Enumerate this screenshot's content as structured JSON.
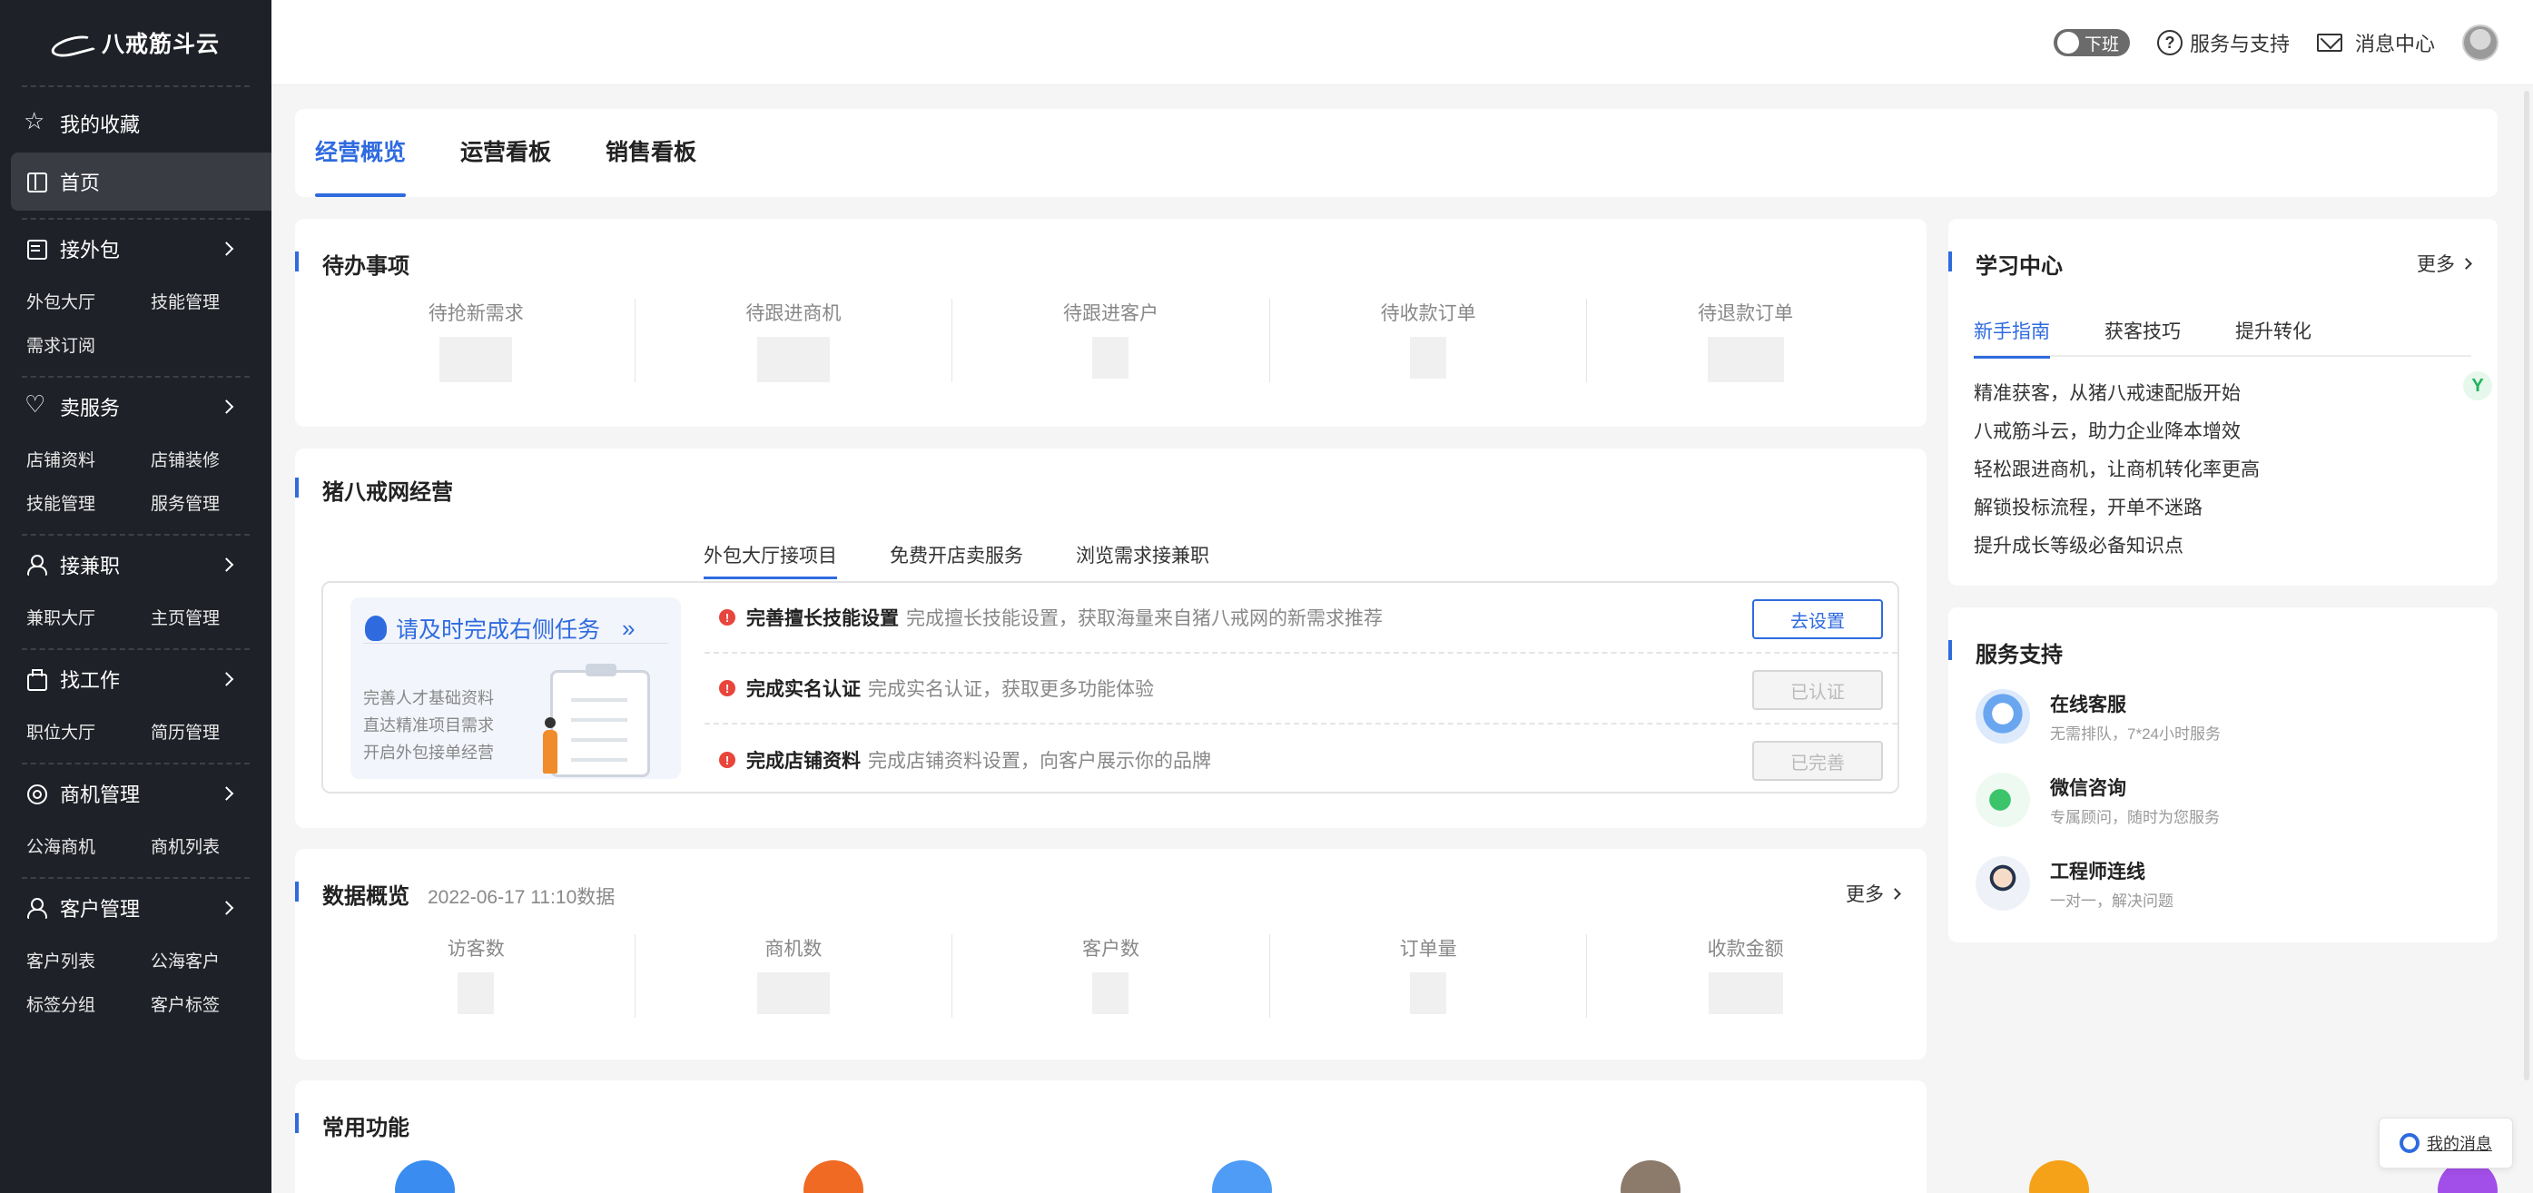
{
  "brand": {
    "name": "八戒筋斗云"
  },
  "sidebar": {
    "favorites": "我的收藏",
    "home": "首页",
    "groups": [
      {
        "label": "接外包",
        "subs": [
          "外包大厅",
          "技能管理",
          "需求订阅"
        ]
      },
      {
        "label": "卖服务",
        "subs": [
          "店铺资料",
          "店铺装修",
          "技能管理",
          "服务管理"
        ]
      },
      {
        "label": "接兼职",
        "subs": [
          "兼职大厅",
          "主页管理"
        ]
      },
      {
        "label": "找工作",
        "subs": [
          "职位大厅",
          "简历管理"
        ]
      },
      {
        "label": "商机管理",
        "subs": [
          "公海商机",
          "商机列表"
        ]
      },
      {
        "label": "客户管理",
        "subs": [
          "客户列表",
          "公海客户",
          "标签分组",
          "客户标签"
        ]
      }
    ]
  },
  "topbar": {
    "toggle_label": "下班",
    "support": "服务与支持",
    "messages": "消息中心"
  },
  "main_tabs": [
    "经营概览",
    "运营看板",
    "销售看板"
  ],
  "todo": {
    "title": "待办事项",
    "stats": [
      "待抢新需求",
      "待跟进商机",
      "待跟进客户",
      "待收款订单",
      "待退款订单"
    ]
  },
  "biz": {
    "title": "猪八戒网经营",
    "tabs": [
      "外包大厅接项目",
      "免费开店卖服务",
      "浏览需求接兼职"
    ],
    "promo_title": "请及时完成右侧任务",
    "promo_lines": [
      "完善人才基础资料",
      "直达精准项目需求",
      "开启外包接单经营"
    ],
    "tasks": [
      {
        "name": "完善擅长技能设置",
        "desc": "完成擅长技能设置，获取海量来自猪八戒网的新需求推荐",
        "button": "去设置",
        "state": "primary"
      },
      {
        "name": "完成实名认证",
        "desc": "完成实名认证，获取更多功能体验",
        "button": "已认证",
        "state": "disabled"
      },
      {
        "name": "完成店铺资料",
        "desc": "完成店铺资料设置，向客户展示你的品牌",
        "button": "已完善",
        "state": "disabled"
      }
    ]
  },
  "data_overview": {
    "title": "数据概览",
    "date": "2022-06-17 11:10数据",
    "more": "更多",
    "stats": [
      "访客数",
      "商机数",
      "客户数",
      "订单量",
      "收款金额"
    ]
  },
  "common": {
    "title": "常用功能",
    "icon_colors": [
      "#3a8cf0",
      "#f06a24",
      "#4e9cf5",
      "#8c7a6b",
      "#f5a218",
      "#a24ee8"
    ]
  },
  "learn": {
    "title": "学习中心",
    "more": "更多",
    "tabs": [
      "新手指南",
      "获客技巧",
      "提升转化"
    ],
    "items": [
      "精准获客，从猪八戒速配版开始",
      "八戒筋斗云，助力企业降本增效",
      "轻松跟进商机，让商机转化率更高",
      "解锁投标流程，开单不迷路",
      "提升成长等级必备知识点"
    ]
  },
  "support": {
    "title": "服务支持",
    "items": [
      {
        "name": "在线客服",
        "desc": "无需排队，7*24小时服务"
      },
      {
        "name": "微信咨询",
        "desc": "专属顾问，随时为您服务"
      },
      {
        "name": "工程师连线",
        "desc": "一对一，解决问题"
      }
    ]
  },
  "float_msg": "我的消息",
  "colors": {
    "accent": "#2f6bdf",
    "sidebar_bg": "#1f2128",
    "alert": "#e8453c"
  }
}
